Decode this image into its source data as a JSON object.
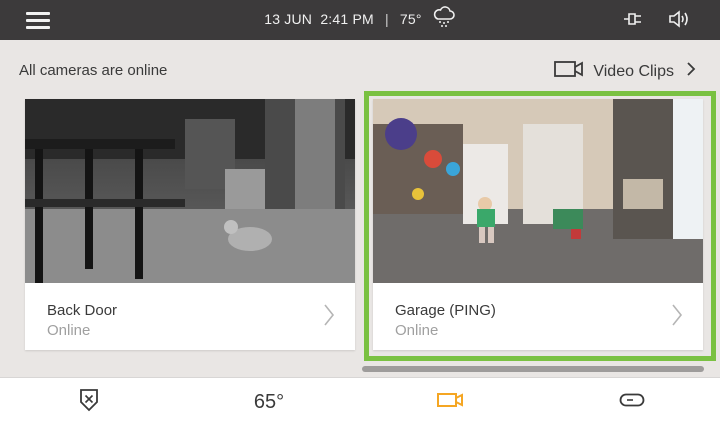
{
  "statusbar": {
    "date": "13 JUN",
    "time": "2:41 PM",
    "separator": "|",
    "temperature": "75°",
    "weather_icon": "rain-cloud-icon",
    "icons": [
      "plug-icon",
      "speaker-icon"
    ]
  },
  "header": {
    "status_text": "All cameras are online",
    "clips_label": "Video Clips"
  },
  "cameras": [
    {
      "name": "Back Door",
      "status": "Online",
      "feed": "night-vision kitchen view with cat"
    },
    {
      "name": "Garage (PING)",
      "status": "Online",
      "feed": "color garage view with child",
      "selected": true
    }
  ],
  "nav": {
    "thermostat_label": "65°",
    "active_tab": "cameras",
    "tabs": [
      "security-shield-icon",
      "thermostat",
      "camera-icon",
      "device-pill-icon"
    ]
  },
  "colors": {
    "topbar": "#3c3a3b",
    "selection": "#7ac142",
    "active_tab": "#f5a623",
    "background": "#e9e6e4"
  }
}
